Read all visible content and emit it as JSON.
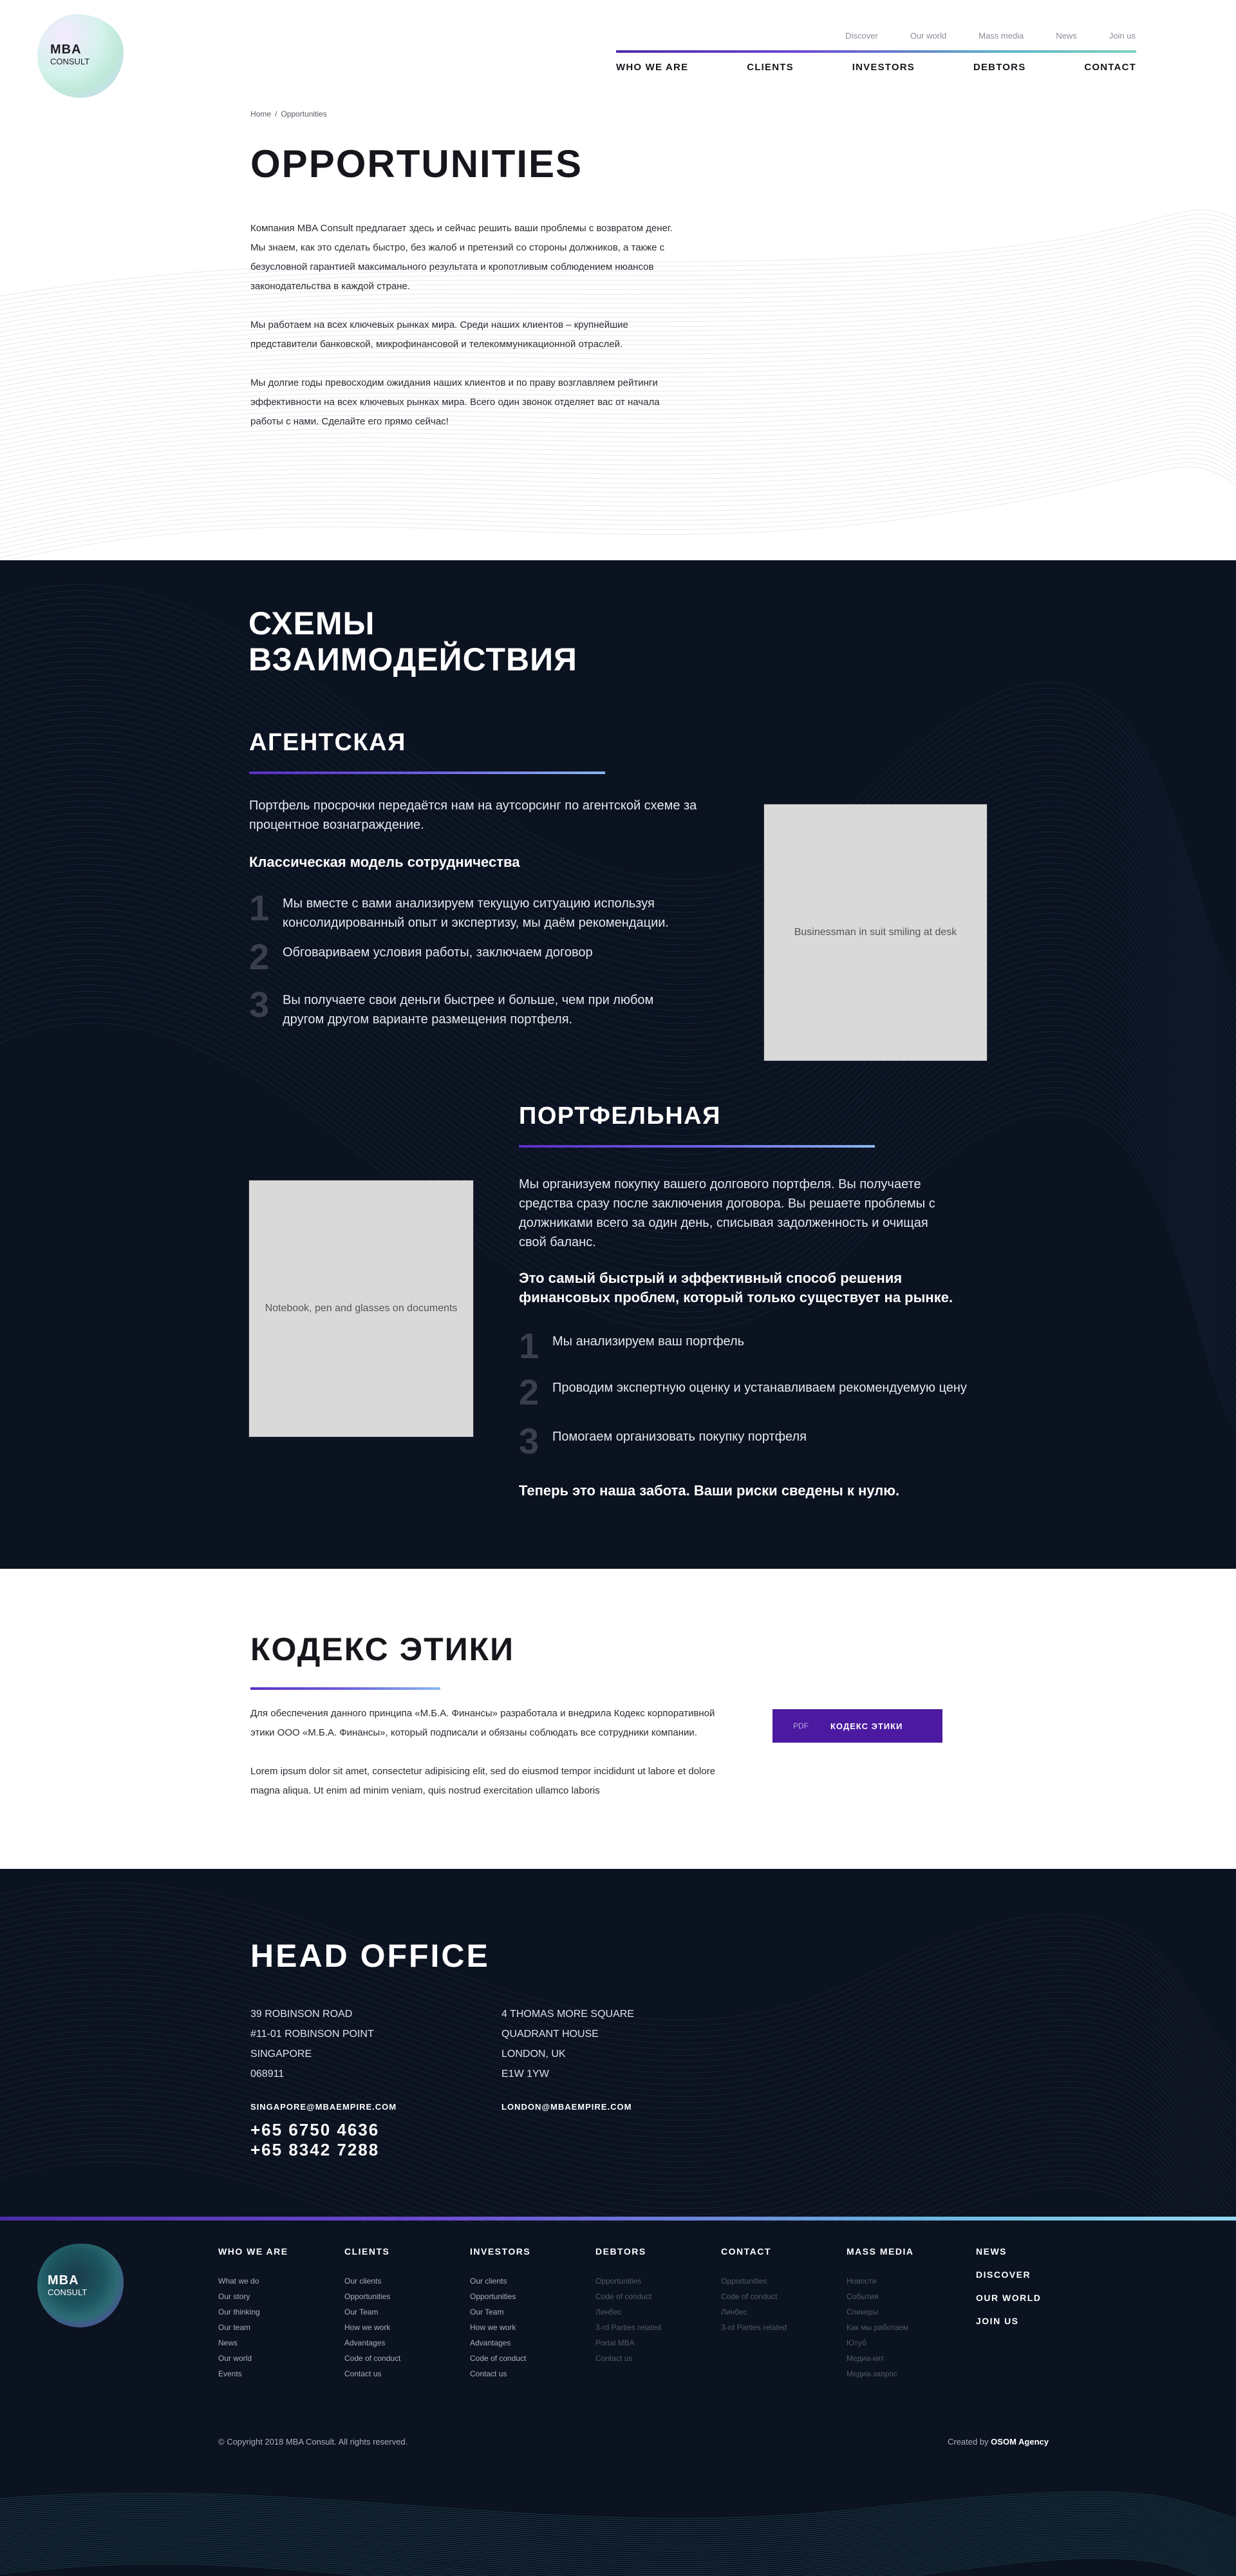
{
  "header": {
    "logo": {
      "brand": "MBA",
      "sub": "CONSULT"
    },
    "top_links": [
      "Discover",
      "Our world",
      "Mass media",
      "News",
      "Join us"
    ],
    "main_nav": [
      "WHO WE ARE",
      "CLIENTS",
      "INVESTORS",
      "DEBTORS",
      "CONTACT"
    ]
  },
  "intro": {
    "breadcrumb": {
      "home": "Home",
      "sep": "/",
      "current": "Opportunities"
    },
    "title": "OPPORTUNITIES",
    "paragraphs": [
      "Компания MBA Consult предлагает здесь и сейчас решить ваши проблемы с возвратом денег. Мы знаем, как это сделать быстро, без жалоб и претензий со стороны должников, а также с безусловной гарантией максимального результата и кропотливым соблюдением нюансов законодательства в каждой стране.",
      "Мы работаем на всех ключевых рынках мира. Среди наших клиентов – крупнейшие представители банковской, микрофинансовой и телекоммуникационной отраслей.",
      "Мы долгие годы превосходим ожидания наших клиентов и по праву возглавляем рейтинги эффективности на всех ключевых рынках мира. Всего один звонок отделяет вас от начала работы с нами. Сделайте его прямо сейчас!"
    ]
  },
  "schemes": {
    "title_line1": "СХЕМЫ",
    "title_line2": "ВЗАИМОДЕЙСТВИЯ",
    "agency": {
      "title": "АГЕНТСКАЯ",
      "intro": "Портфель просрочки передаётся нам  на аутсорсинг по агентской схеме за процентное вознаграждение.",
      "subheading": "Классическая модель сотрудничества",
      "steps": [
        {
          "num": "1",
          "text": "Мы вместе с вами анализируем текущую ситуацию используя консолидированный опыт и экспертизу, мы даём рекомендации."
        },
        {
          "num": "2",
          "text": "Обговариваем условия работы, заключаем договор"
        },
        {
          "num": "3",
          "text": "Вы получаете свои деньги быстрее и больше, чем при любом другом другом варианте размещения портфеля."
        }
      ],
      "photo_alt": "Businessman in suit smiling at desk"
    },
    "portfolio": {
      "title": "ПОРТФЕЛЬНАЯ",
      "intro": "Мы организуем покупку вашего долгового портфеля. Вы получаете средства сразу после заключения договора. Вы решаете проблемы с должниками всего за один день, списывая задолженность и очищая свой баланс.",
      "subheading": "Это самый быстрый и эффективный способ решения финансовых проблем, который только существует на рынке.",
      "steps": [
        {
          "num": "1",
          "text": "Мы анализируем ваш портфель"
        },
        {
          "num": "2",
          "text": "Проводим экспертную оценку и устанавливаем рекомендуемую цену"
        },
        {
          "num": "3",
          "text": "Помогаем организовать покупку портфеля"
        }
      ],
      "closing": "Теперь это наша забота. Ваши риски сведены к нулю.",
      "photo_alt": "Notebook, pen and glasses on documents"
    }
  },
  "ethics": {
    "title": "КОДЕКС ЭТИКИ",
    "paragraphs": [
      "Для обеспечения данного принципа «М.Б.А. Финансы» разработала и внедрила Кодекс корпоративной этики ООО «М.Б.А. Финансы», который подписали и обязаны соблюдать все сотрудники компании.",
      "Lorem ipsum dolor sit amet, consectetur adipisicing elit, sed do eiusmod tempor incididunt ut labore et dolore magna aliqua. Ut enim ad minim veniam, quis nostrud exercitation ullamco laboris"
    ],
    "button": {
      "tag": "PDF",
      "label": "КОДЕКС ЭТИКИ"
    }
  },
  "office": {
    "title": "HEAD OFFICE",
    "singapore": {
      "lines": [
        "39 ROBINSON ROAD",
        "#11-01 ROBINSON POINT",
        "SINGAPORE",
        "068911"
      ],
      "email": "SINGAPORE@MBAEMPIRE.COM",
      "phones": [
        "+65 6750 4636",
        "+65 8342 7288"
      ]
    },
    "london": {
      "lines": [
        "4 THOMAS MORE SQUARE",
        "QUADRANT HOUSE",
        "LONDON, UK",
        "E1W 1YW"
      ],
      "email": "LONDON@MBAEMPIRE.COM"
    }
  },
  "footer": {
    "logo": {
      "brand": "MBA",
      "sub": "CONSULT"
    },
    "columns": [
      {
        "title": "WHO WE ARE",
        "items": [
          "What we do",
          "Our story",
          "Our thinking",
          "Our team",
          "News",
          "Our world",
          "Events"
        ],
        "dim": false
      },
      {
        "title": "CLIENTS",
        "items": [
          "Our clients",
          "Opportunities",
          "Our Team",
          "How we work",
          "Advantages",
          "Code of conduct",
          "Contact us"
        ],
        "dim": false
      },
      {
        "title": "INVESTORS",
        "items": [
          "Our clients",
          "Opportunities",
          "Our Team",
          "How we work",
          "Advantages",
          "Code of conduct",
          "Contact us"
        ],
        "dim": false
      },
      {
        "title": "DEBTORS",
        "items": [
          "Opportunities",
          "Code of conduct",
          "Линбес",
          "3-rd Parties related",
          "Portal MBA",
          "Contact us"
        ],
        "dim": true
      },
      {
        "title": "CONTACT",
        "items": [
          "Opportunities",
          "Code of conduct",
          "Линбес",
          "3-rd Parties related"
        ],
        "dim": true
      },
      {
        "title": "MASS MEDIA",
        "items": [
          "Новости",
          "События",
          "Спикеры",
          "Как мы работаем",
          "Ютуб",
          "Медиа-кит",
          "Медиа-запрос"
        ],
        "dim": true
      }
    ],
    "right_links": [
      "NEWS",
      "DISCOVER",
      "OUR WORLD",
      "JOIN US"
    ],
    "copyright": "© Copyright 2018 MBA Consult. All rights reserved.",
    "created_prefix": "Created by",
    "created_by": "OSOM Agency"
  }
}
